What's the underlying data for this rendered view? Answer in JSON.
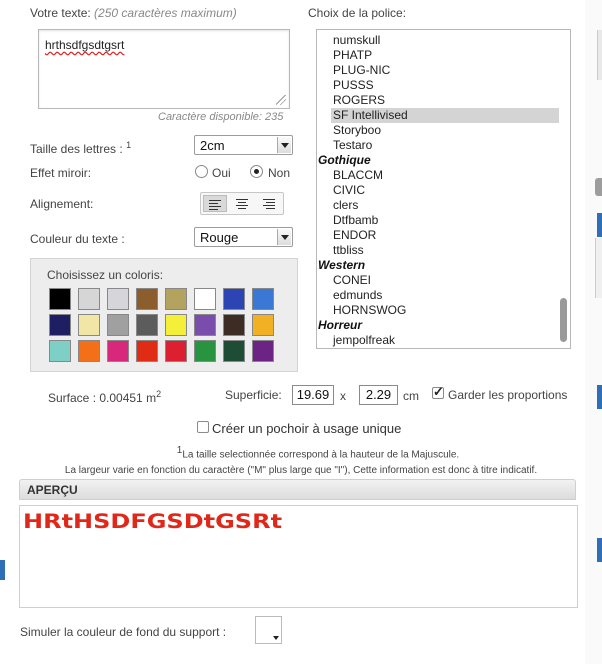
{
  "text_section": {
    "label": "Votre texte:",
    "hint": "(250 caractères maximum)",
    "value": "hrthsdfgsdtgsrt",
    "remaining": "Caractère disponible: 235"
  },
  "font_section": {
    "label": "Choix de la police:",
    "options": [
      {
        "kind": "font",
        "label": "numskull"
      },
      {
        "kind": "font",
        "label": "PHATP"
      },
      {
        "kind": "font",
        "label": "PLUG-NIC"
      },
      {
        "kind": "font",
        "label": "PUSSS"
      },
      {
        "kind": "font",
        "label": "ROGERS"
      },
      {
        "kind": "font",
        "label": "SF Intellivised",
        "selected": true
      },
      {
        "kind": "font",
        "label": "Storyboo"
      },
      {
        "kind": "font",
        "label": "Testaro"
      },
      {
        "kind": "group",
        "label": "Gothique"
      },
      {
        "kind": "font",
        "label": "BLACCM"
      },
      {
        "kind": "font",
        "label": "CIVIC"
      },
      {
        "kind": "font",
        "label": "clers"
      },
      {
        "kind": "font",
        "label": "Dtfbamb"
      },
      {
        "kind": "font",
        "label": "ENDOR"
      },
      {
        "kind": "font",
        "label": "ttbliss"
      },
      {
        "kind": "group",
        "label": "Western"
      },
      {
        "kind": "font",
        "label": "CONEI"
      },
      {
        "kind": "font",
        "label": "edmunds"
      },
      {
        "kind": "font",
        "label": "HORNSWOG"
      },
      {
        "kind": "group",
        "label": "Horreur"
      },
      {
        "kind": "font",
        "label": "jempolfreak"
      }
    ]
  },
  "size": {
    "label": "Taille des lettres :",
    "sup": "1",
    "value": "2cm"
  },
  "mirror": {
    "label": "Effet miroir:",
    "oui": "Oui",
    "non": "Non",
    "selected": "Non"
  },
  "alignment": {
    "label": "Alignement:",
    "selected": "left"
  },
  "text_color": {
    "label": "Couleur du texte :",
    "value": "Rouge"
  },
  "palette": {
    "title": "Choisissez un coloris:",
    "colors": [
      "#000000",
      "#d6d6d6",
      "#d6d6da",
      "#8c5e2d",
      "#b4a35e",
      "#ffffff",
      "#2d45b4",
      "#3b78d6",
      "#1e1e62",
      "#f2e6a6",
      "#a0a0a0",
      "#5c5c5c",
      "#f4ef38",
      "#7a4dac",
      "#3c2c24",
      "#f2b024",
      "#7ed0c6",
      "#f47018",
      "#d8287c",
      "#e02c14",
      "#dc2030",
      "#289440",
      "#1e4c34",
      "#6c2484"
    ]
  },
  "surface": {
    "label": "Surface : 0.00451 m",
    "sup": "2"
  },
  "superficie": {
    "label": "Superficie:",
    "width": "19.69",
    "x": "x",
    "height": "2.29",
    "unit": "cm",
    "keep_label": "Garder les proportions"
  },
  "stencil": {
    "label": "Créer un pochoir à usage unique"
  },
  "note": {
    "sup": "1",
    "line1": "La taille selectionnée correspond à la hauteur de la Majuscule.",
    "line2": "La largeur varie en fonction du caractère (\"M\" plus large que \"I\"), Cette information est donc à titre indicatif."
  },
  "preview": {
    "header": "APERÇU",
    "text": "HRtHSDFGSDtGSRt",
    "color": "#e0281a"
  },
  "background": {
    "label": "Simuler la couleur de fond du support :"
  },
  "accent": "#2f6fb6"
}
